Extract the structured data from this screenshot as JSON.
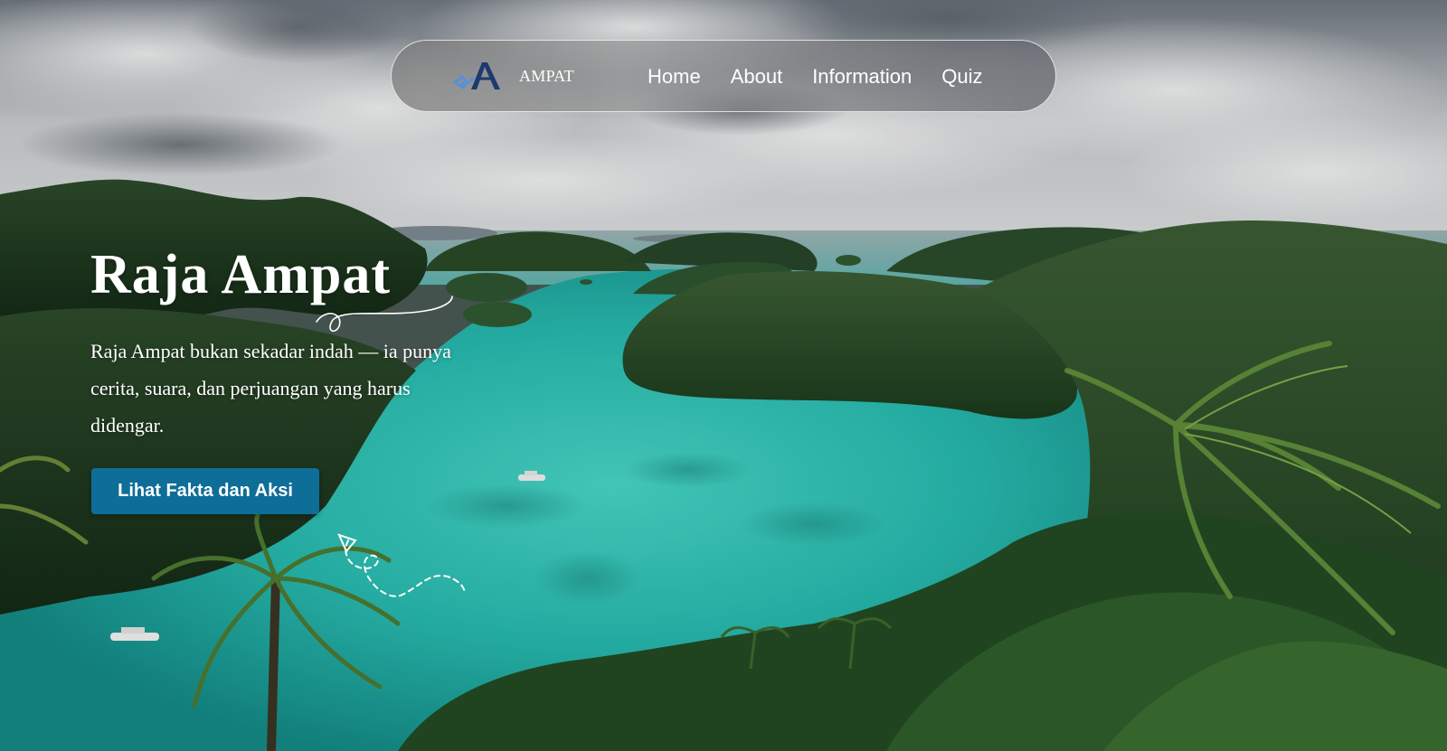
{
  "navbar": {
    "logo_icon": "ampat-logo-icon",
    "brand": "AMPAT",
    "links": [
      "Home",
      "About",
      "Information",
      "Quiz"
    ]
  },
  "hero": {
    "title": "Raja Ampat",
    "description": "Raja Ampat bukan sekadar indah — ia punya cerita, suara, dan perjuangan yang harus didengar.",
    "cta_label": "Lihat Fakta dan Aksi"
  },
  "colors": {
    "cta": "#0e6e98",
    "logo_dark": "#1d3a6e",
    "logo_light": "#5b8fd6",
    "lagoon": "#2cc2b5"
  }
}
